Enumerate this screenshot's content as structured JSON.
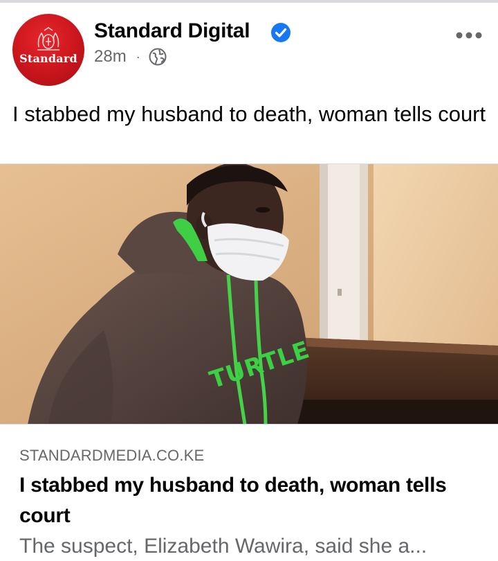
{
  "post": {
    "page_name": "Standard Digital",
    "avatar_wordmark": "Standard",
    "timestamp": "28m",
    "separator": "·",
    "audience_icon": "globe-icon",
    "verified_icon": "verified-check-icon",
    "more_icon": "more-options-icon",
    "text": "I stabbed my husband to death, woman tells court"
  },
  "photo": {
    "shirt_text": "TURTLE",
    "alt": "Woman in a grey hoodie wearing a face mask"
  },
  "link_preview": {
    "domain": "STANDARDMEDIA.CO.KE",
    "title": "I stabbed my husband to death, woman tells court",
    "description": "The suspect, Elizabeth Wawira, said she a..."
  },
  "colors": {
    "brand_red": "#c9151c",
    "verified_blue": "#1877f2",
    "secondary_text": "#65676b",
    "primary_text": "#050505"
  }
}
